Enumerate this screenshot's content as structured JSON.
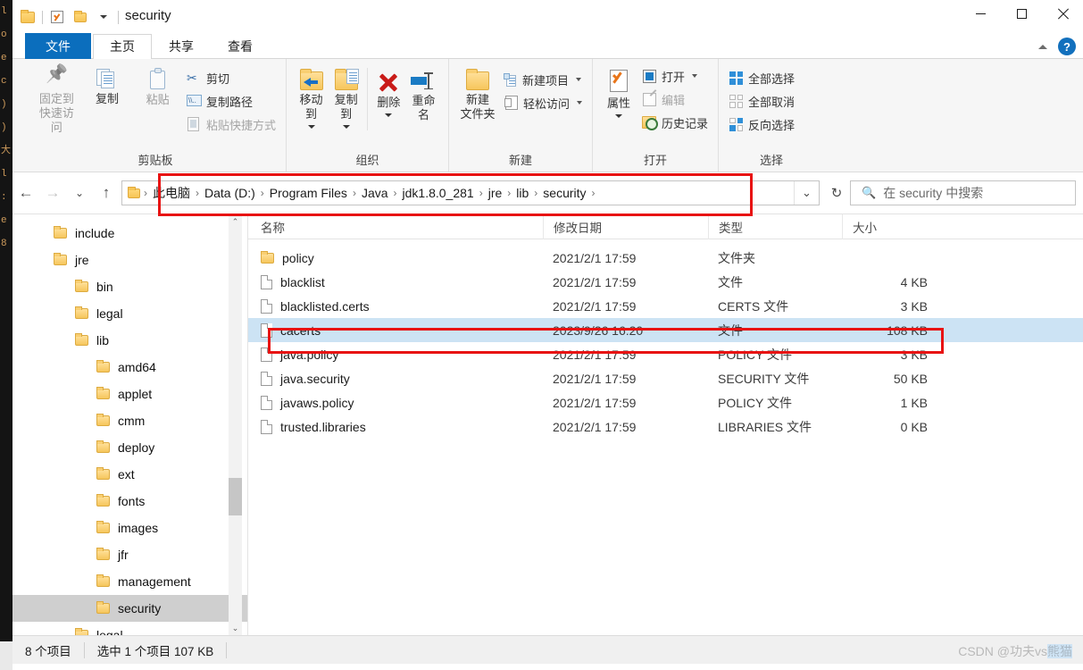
{
  "window": {
    "title": "security",
    "quick_access": [
      "folder-icon",
      "checkbox-icon",
      "folder-icon",
      "dropdown-caret"
    ],
    "controls": {
      "minimize": "minimize-icon",
      "maximize": "maximize-icon",
      "close": "close-icon"
    }
  },
  "tabs": [
    {
      "label": "文件",
      "name": "tab-file"
    },
    {
      "label": "主页",
      "name": "tab-home"
    },
    {
      "label": "共享",
      "name": "tab-share"
    },
    {
      "label": "查看",
      "name": "tab-view"
    }
  ],
  "ribbon_right": {
    "collapse": "chevron-up-icon",
    "help": "?"
  },
  "ribbon": {
    "groups": [
      {
        "name": "剪贴板",
        "big": [
          {
            "label": "固定到\n快速访问",
            "icon": "pin-icon",
            "dim": true
          },
          {
            "label": "复制",
            "icon": "copy-icon",
            "dim": false
          },
          {
            "label": "粘贴",
            "icon": "paste-icon",
            "dim": true
          }
        ],
        "small": [
          {
            "label": "剪切",
            "icon": "scissors-icon",
            "dim": false
          },
          {
            "label": "复制路径",
            "icon": "copy-path-icon",
            "dim": false
          },
          {
            "label": "粘贴快捷方式",
            "icon": "paste-shortcut-icon",
            "dim": true
          }
        ]
      },
      {
        "name": "组织",
        "big": [
          {
            "label": "移动到",
            "icon": "move-to-icon",
            "caret": true
          },
          {
            "label": "复制到",
            "icon": "copy-to-icon",
            "caret": true
          },
          {
            "label": "删除",
            "icon": "delete-icon",
            "caret": true
          },
          {
            "label": "重命名",
            "icon": "rename-icon",
            "caret": false
          }
        ],
        "small": []
      },
      {
        "name": "新建",
        "big": [
          {
            "label": "新建\n文件夹",
            "icon": "new-folder-icon"
          }
        ],
        "small": [
          {
            "label": "新建项目",
            "icon": "new-item-icon",
            "caret": true
          },
          {
            "label": "轻松访问",
            "icon": "easy-access-icon",
            "caret": true
          }
        ]
      },
      {
        "name": "打开",
        "big": [
          {
            "label": "属性",
            "icon": "properties-icon",
            "caret": true
          }
        ],
        "small": [
          {
            "label": "打开",
            "icon": "open-icon",
            "caret": true
          },
          {
            "label": "编辑",
            "icon": "edit-icon",
            "dim": true
          },
          {
            "label": "历史记录",
            "icon": "history-icon"
          }
        ]
      },
      {
        "name": "选择",
        "big": [],
        "small": [
          {
            "label": "全部选择",
            "icon": "select-all-icon"
          },
          {
            "label": "全部取消",
            "icon": "select-none-icon"
          },
          {
            "label": "反向选择",
            "icon": "invert-selection-icon"
          }
        ]
      }
    ]
  },
  "nav": {
    "back": "back-arrow-icon",
    "forward": "forward-arrow-icon",
    "recent": "chevron-down-icon",
    "up": "up-arrow-icon",
    "refresh": "refresh-icon",
    "address_dropdown": "chevron-down-icon"
  },
  "breadcrumb": [
    "此电脑",
    "Data (D:)",
    "Program Files",
    "Java",
    "jdk1.8.0_281",
    "jre",
    "lib",
    "security"
  ],
  "search": {
    "placeholder": "在 security 中搜索",
    "icon": "search-icon"
  },
  "tree": {
    "items": [
      {
        "label": "include",
        "indent": 1,
        "selected": false
      },
      {
        "label": "jre",
        "indent": 1,
        "selected": false
      },
      {
        "label": "bin",
        "indent": 2,
        "selected": false
      },
      {
        "label": "legal",
        "indent": 2,
        "selected": false
      },
      {
        "label": "lib",
        "indent": 2,
        "selected": false
      },
      {
        "label": "amd64",
        "indent": 3,
        "selected": false
      },
      {
        "label": "applet",
        "indent": 3,
        "selected": false
      },
      {
        "label": "cmm",
        "indent": 3,
        "selected": false
      },
      {
        "label": "deploy",
        "indent": 3,
        "selected": false
      },
      {
        "label": "ext",
        "indent": 3,
        "selected": false
      },
      {
        "label": "fonts",
        "indent": 3,
        "selected": false
      },
      {
        "label": "images",
        "indent": 3,
        "selected": false
      },
      {
        "label": "jfr",
        "indent": 3,
        "selected": false
      },
      {
        "label": "management",
        "indent": 3,
        "selected": false
      },
      {
        "label": "security",
        "indent": 3,
        "selected": true
      },
      {
        "label": "legal",
        "indent": 2,
        "selected": false
      }
    ]
  },
  "file_list": {
    "columns": [
      "名称",
      "修改日期",
      "类型",
      "大小"
    ],
    "rows": [
      {
        "name": "policy",
        "date": "2021/2/1 17:59",
        "type": "文件夹",
        "size": "",
        "kind": "folder",
        "selected": false
      },
      {
        "name": "blacklist",
        "date": "2021/2/1 17:59",
        "type": "文件",
        "size": "4 KB",
        "kind": "file",
        "selected": false
      },
      {
        "name": "blacklisted.certs",
        "date": "2021/2/1 17:59",
        "type": "CERTS 文件",
        "size": "3 KB",
        "kind": "file",
        "selected": false
      },
      {
        "name": "cacerts",
        "date": "2023/9/26 16:20",
        "type": "文件",
        "size": "108 KB",
        "kind": "file",
        "selected": true
      },
      {
        "name": "java.policy",
        "date": "2021/2/1 17:59",
        "type": "POLICY 文件",
        "size": "3 KB",
        "kind": "file",
        "selected": false
      },
      {
        "name": "java.security",
        "date": "2021/2/1 17:59",
        "type": "SECURITY 文件",
        "size": "50 KB",
        "kind": "file",
        "selected": false
      },
      {
        "name": "javaws.policy",
        "date": "2021/2/1 17:59",
        "type": "POLICY 文件",
        "size": "1 KB",
        "kind": "file",
        "selected": false
      },
      {
        "name": "trusted.libraries",
        "date": "2021/2/1 17:59",
        "type": "LIBRARIES 文件",
        "size": "0 KB",
        "kind": "file",
        "selected": false
      }
    ]
  },
  "status": {
    "item_count": "8 个项目",
    "selection": "选中 1 个项目  107 KB"
  },
  "watermark": {
    "prefix": "CSDN @功夫vs",
    "highlight": "熊猫"
  },
  "colors": {
    "accent": "#0b6ebd",
    "selection": "#cce3f4",
    "tree_selection": "#cfcfcf",
    "annotation": "#e81313",
    "folder": "#f6c65c"
  },
  "bg_window_text": "l\no\ne\nc\n)\n)\n大\nl\n:\ne\n8"
}
